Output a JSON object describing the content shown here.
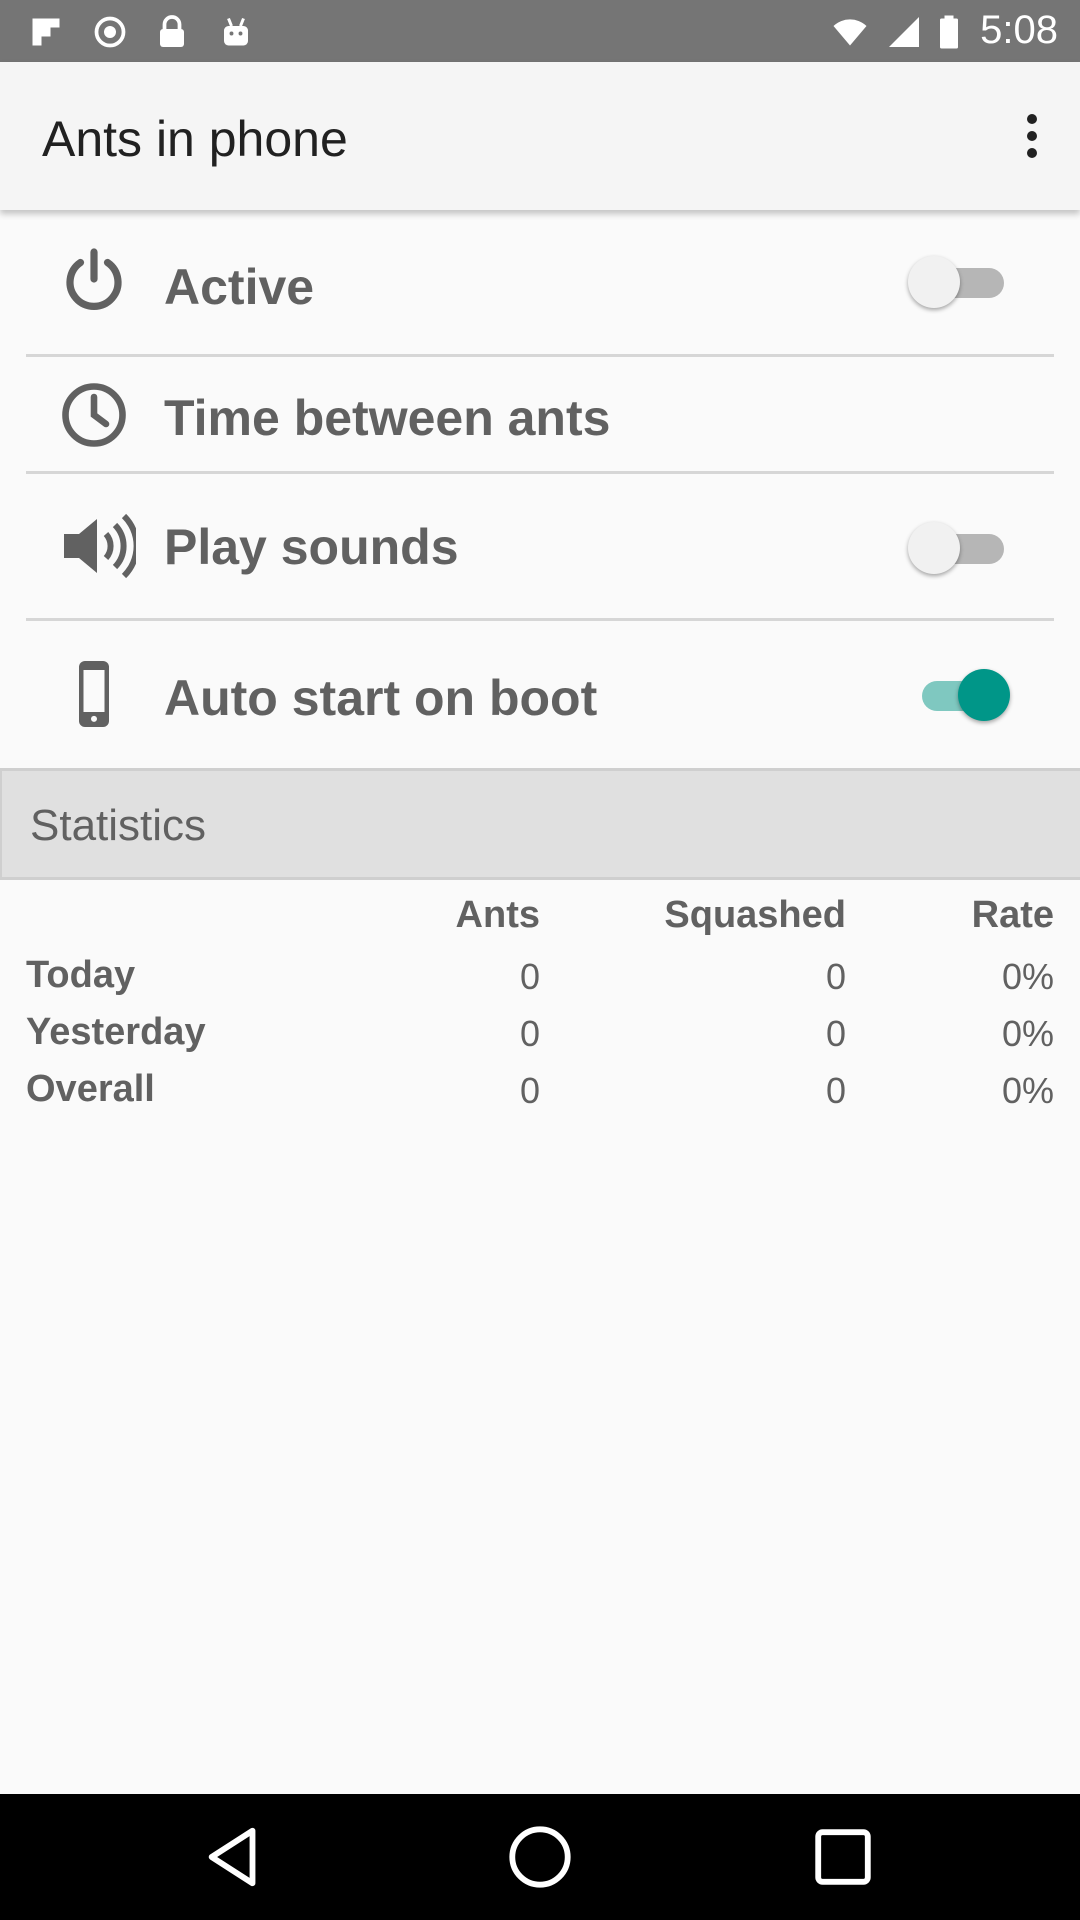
{
  "status_bar": {
    "time": "5:08",
    "icons": [
      "flipboard-icon",
      "circle-icon",
      "lock-icon",
      "android-icon"
    ],
    "right_icons": [
      "wifi-icon",
      "signal-icon",
      "battery-icon"
    ]
  },
  "app_bar": {
    "title": "Ants in phone",
    "overflow_icon": "more-vertical-icon"
  },
  "settings": [
    {
      "label": "Active",
      "icon": "power-icon",
      "switch": false
    },
    {
      "label": "Time between ants",
      "icon": "clock-icon"
    },
    {
      "label": "Play sounds",
      "icon": "volume-icon",
      "switch": false
    },
    {
      "label": "Auto start on boot",
      "icon": "phone-icon",
      "switch": true
    }
  ],
  "statistics": {
    "title": "Statistics",
    "columns": [
      "Ants",
      "Squashed",
      "Rate"
    ],
    "rows": [
      {
        "label": "Today",
        "ants": "0",
        "squashed": "0",
        "rate": "0%"
      },
      {
        "label": "Yesterday",
        "ants": "0",
        "squashed": "0",
        "rate": "0%"
      },
      {
        "label": "Overall",
        "ants": "0",
        "squashed": "0",
        "rate": "0%"
      }
    ]
  },
  "nav_bar": {
    "buttons": [
      "back-icon",
      "home-icon",
      "recents-icon"
    ]
  },
  "colors": {
    "accent": "#009688",
    "status_bar": "#757575",
    "app_bar": "#f5f5f5",
    "stats_header": "#e0e0e0"
  }
}
